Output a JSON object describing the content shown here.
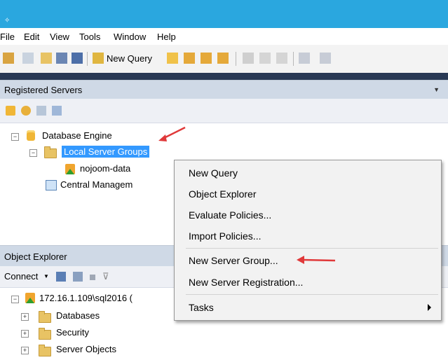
{
  "menubar": {
    "items": [
      "File",
      "Edit",
      "View",
      "Tools",
      "Window",
      "Help"
    ]
  },
  "toolbar": {
    "new_query_label": "New Query"
  },
  "registered_servers": {
    "title": "Registered Servers",
    "tree": {
      "root_label": "Database Engine",
      "local_groups_label": "Local Server Groups",
      "server_label": "nojoom-data",
      "central_label": "Central Managem"
    }
  },
  "object_explorer": {
    "title": "Object Explorer",
    "connect_label": "Connect",
    "server_label": "172.16.1.109\\sql2016 (",
    "children": [
      "Databases",
      "Security",
      "Server Objects"
    ]
  },
  "context_menu": {
    "items": [
      "New Query",
      "Object Explorer",
      "Evaluate Policies...",
      "Import Policies...",
      "New Server Group...",
      "New Server Registration...",
      "Tasks"
    ]
  },
  "colors": {
    "title_bar": "#2aa7df",
    "selection": "#3399ff",
    "annotation_arrow": "#e0393a"
  }
}
